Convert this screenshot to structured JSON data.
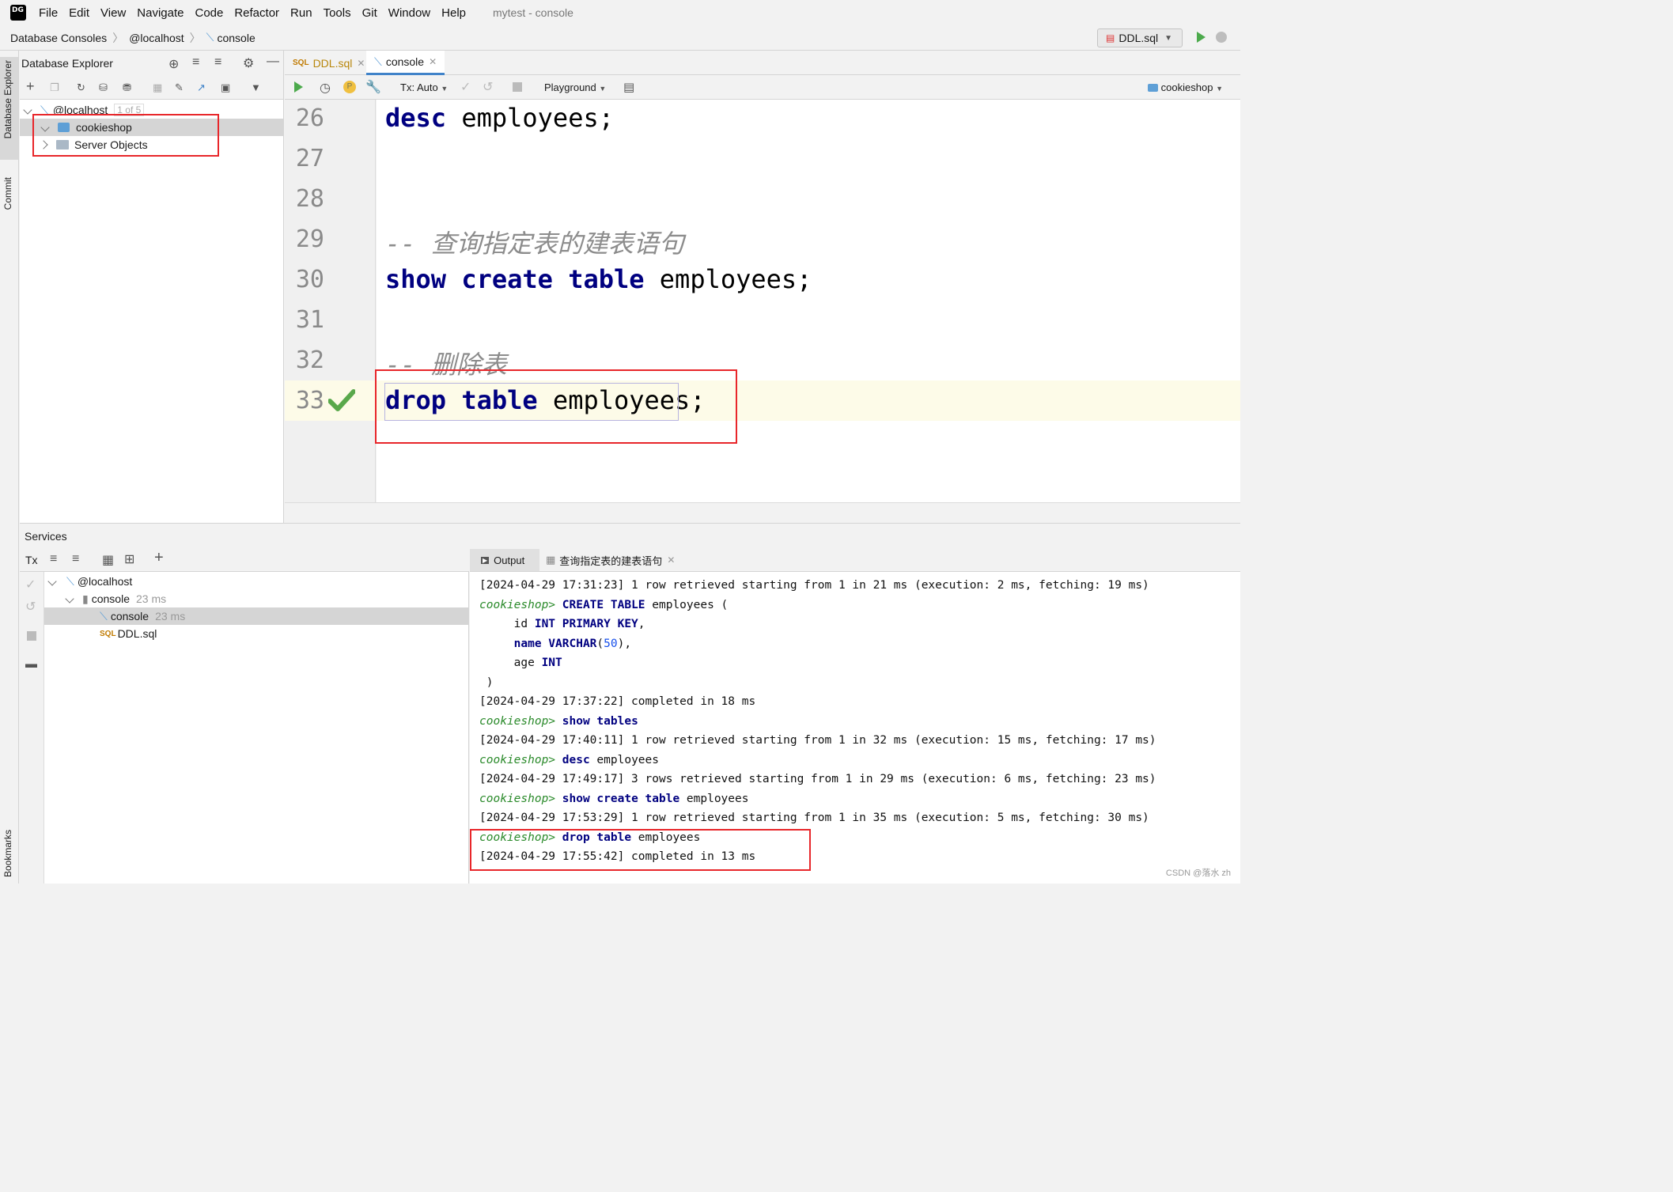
{
  "menubar": {
    "items": [
      "File",
      "Edit",
      "View",
      "Navigate",
      "Code",
      "Refactor",
      "Run",
      "Tools",
      "Git",
      "Window",
      "Help"
    ],
    "window_title": "mytest - console"
  },
  "breadcrumb": {
    "items": [
      "Database Consoles",
      "@localhost",
      "console"
    ]
  },
  "run_config": {
    "label": "DDL.sql"
  },
  "left_strip": {
    "tabs": [
      "Database Explorer",
      "Commit",
      "Bookmarks"
    ]
  },
  "db_explorer": {
    "title": "Database Explorer",
    "tree": [
      {
        "label": "@localhost",
        "badge": "1 of 5"
      },
      {
        "label": "cookieshop"
      },
      {
        "label": "Server Objects"
      }
    ]
  },
  "editor": {
    "tabs": [
      {
        "label": "DDL.sql",
        "active": false
      },
      {
        "label": "console",
        "active": true
      }
    ],
    "toolbar": {
      "tx_mode": "Tx: Auto",
      "playground": "Playground",
      "schema": "cookieshop"
    },
    "lines": [
      {
        "no": "26",
        "text": "desc employees;"
      },
      {
        "no": "27",
        "text": ""
      },
      {
        "no": "28",
        "text": ""
      },
      {
        "no": "29",
        "text": "-- 查询指定表的建表语句"
      },
      {
        "no": "30",
        "text": "show create table employees;"
      },
      {
        "no": "31",
        "text": ""
      },
      {
        "no": "32",
        "text": "-- 删除表"
      },
      {
        "no": "33",
        "text": "drop table employees;"
      }
    ]
  },
  "services": {
    "title": "Services",
    "tx_label": "Tx",
    "tree": [
      {
        "label": "@localhost",
        "meta": ""
      },
      {
        "label": "console",
        "meta": "23 ms"
      },
      {
        "label": "console",
        "meta": "23 ms"
      },
      {
        "label": "DDL.sql",
        "meta": ""
      }
    ],
    "output_tabs": [
      "Output",
      "查询指定表的建表语句"
    ],
    "output_lines": [
      "[2024-04-29 17:31:23] 1 row retrieved starting from 1 in 21 ms (execution: 2 ms, fetching: 19 ms)",
      "cookieshop> CREATE TABLE employees (",
      "     id INT PRIMARY KEY,",
      "     name VARCHAR(50),",
      "     age INT",
      " )",
      "[2024-04-29 17:37:22] completed in 18 ms",
      "cookieshop> show tables",
      "[2024-04-29 17:40:11] 1 row retrieved starting from 1 in 32 ms (execution: 15 ms, fetching: 17 ms)",
      "cookieshop> desc employees",
      "[2024-04-29 17:49:17] 3 rows retrieved starting from 1 in 29 ms (execution: 6 ms, fetching: 23 ms)",
      "cookieshop> show create table employees",
      "[2024-04-29 17:53:29] 1 row retrieved starting from 1 in 35 ms (execution: 5 ms, fetching: 30 ms)",
      "cookieshop> drop table employees",
      "[2024-04-29 17:55:42] completed in 13 ms"
    ]
  },
  "watermark": "CSDN @落水 zh",
  "colors": {
    "accent": "#4083c9",
    "highlight_box": "#e8262a",
    "keyword": "#000080",
    "prompt": "#2a8a2a"
  }
}
